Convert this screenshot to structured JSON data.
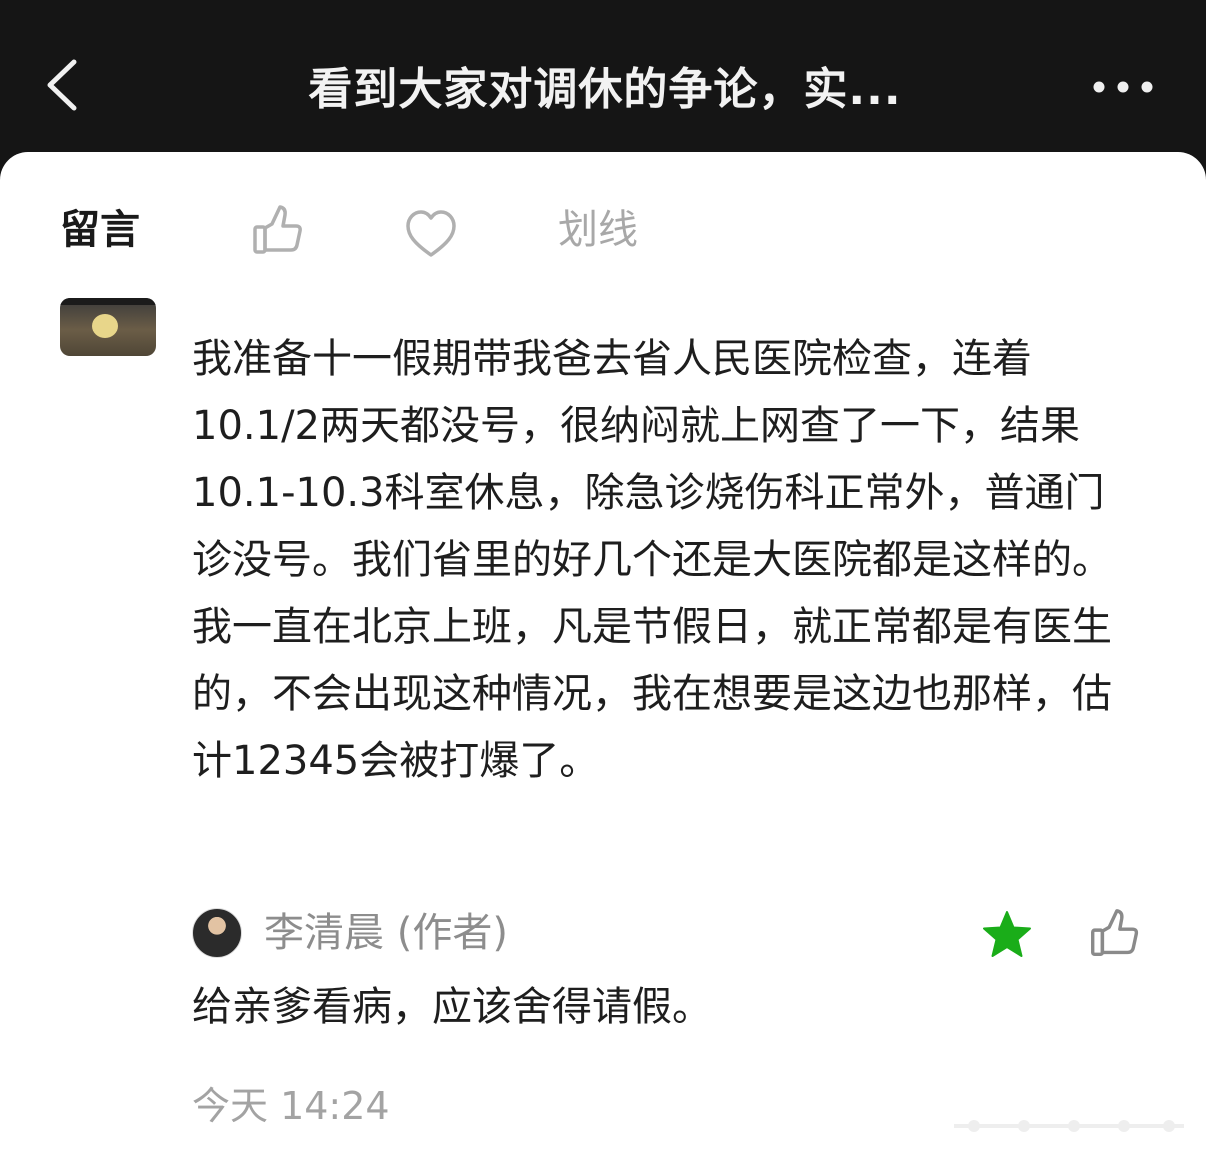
{
  "header": {
    "title": "看到大家对调休的争论，实..."
  },
  "tabs": {
    "comment": "留言",
    "underline": "划线"
  },
  "comment": {
    "paragraphs": [
      "我准备十一假期带我爸去省人民医院检查，连着10.1/2两天都没号，很纳闷就上网查了一下，结果10.1-10.3科室休息，除急诊烧伤科正常外，普通门诊没号。我们省里的好几个还是大医院都是这样的。",
      "我一直在北京上班，凡是节假日，就正常都是有医生的，不会出现这种情况，我在想要是这边也那样，估计12345会被打爆了。"
    ]
  },
  "reply": {
    "author": "李清晨 (作者)",
    "text": "给亲爹看病，应该舍得请假。",
    "time": "今天 14:24"
  },
  "colors": {
    "topbar": "#151515",
    "star": "#1aad19",
    "text": "#1e1e1e",
    "muted": "#a3a3a3"
  },
  "icons": {
    "back": "chevron-left-icon",
    "more": "ellipsis-icon",
    "like": "thumbs-up-icon",
    "favorite": "heart-icon",
    "star": "star-icon"
  }
}
